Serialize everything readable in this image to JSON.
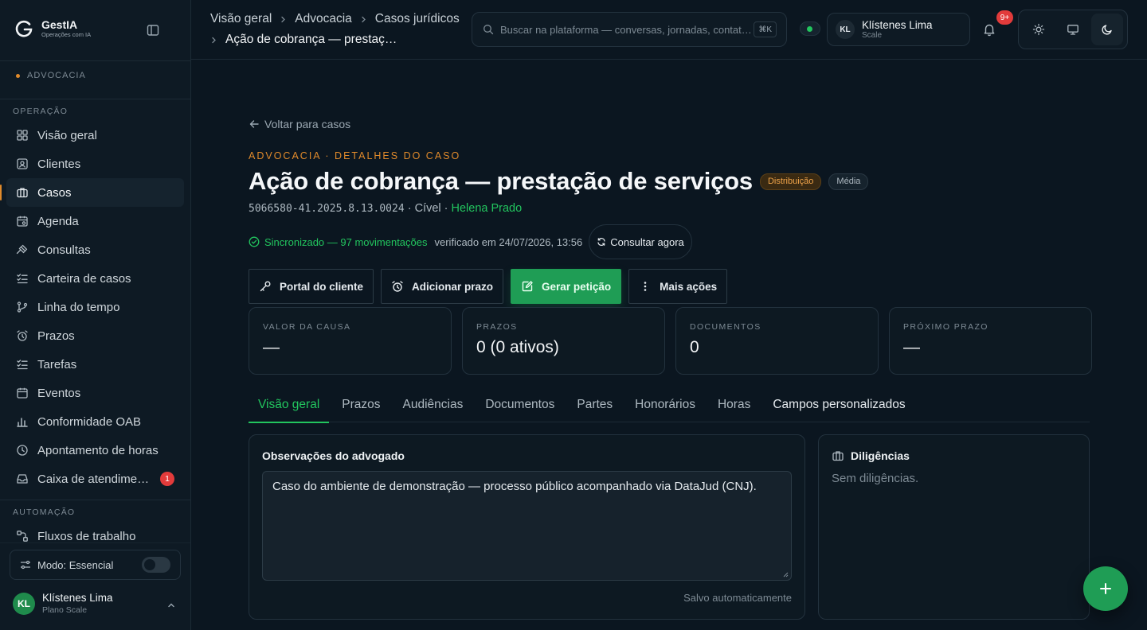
{
  "brand": {
    "name": "GestIA",
    "subtitle": "Operações com IA"
  },
  "workspace": "ADVOCACIA",
  "sidebar": {
    "section_operacao": "OPERAÇÃO",
    "section_automacao": "AUTOMAÇÃO",
    "items": [
      {
        "label": "Visão geral",
        "icon": "grid-icon"
      },
      {
        "label": "Clientes",
        "icon": "contact-icon"
      },
      {
        "label": "Casos",
        "icon": "briefcase-icon",
        "active": true
      },
      {
        "label": "Agenda",
        "icon": "calendar-icon"
      },
      {
        "label": "Consultas",
        "icon": "gavel-icon"
      },
      {
        "label": "Carteira de casos",
        "icon": "checklist-icon"
      },
      {
        "label": "Linha do tempo",
        "icon": "branch-icon"
      },
      {
        "label": "Prazos",
        "icon": "alarm-icon"
      },
      {
        "label": "Tarefas",
        "icon": "checklist-icon"
      },
      {
        "label": "Eventos",
        "icon": "calendar-icon"
      },
      {
        "label": "Conformidade OAB",
        "icon": "bar-chart-icon"
      },
      {
        "label": "Apontamento de horas",
        "icon": "clock-icon"
      },
      {
        "label": "Caixa de atendimento",
        "icon": "inbox-icon",
        "badge": "1"
      }
    ],
    "automation_items": [
      {
        "label": "Fluxos de trabalho",
        "icon": "workflow-icon"
      }
    ],
    "mode_label": "Modo: Essencial",
    "user": {
      "initials": "KL",
      "name": "Klístenes Lima",
      "plan": "Plano Scale"
    }
  },
  "topbar": {
    "breadcrumbs": [
      "Visão geral",
      "Advocacia",
      "Casos jurídicos"
    ],
    "current": "Ação de cobrança — prestação de serviços",
    "search_placeholder": "Buscar na plataforma — conversas, jornadas, contatos...",
    "search_shortcut": "⌘K",
    "account": {
      "initials": "KL",
      "name": "Klístenes Lima",
      "plan": "Scale"
    },
    "notifications": "9+"
  },
  "case": {
    "back_label": "Voltar para casos",
    "eyebrow": "ADVOCACIA · DETALHES DO CASO",
    "title": "Ação de cobrança — prestação de serviços",
    "phase": "Distribuição",
    "priority": "Média",
    "number": "5066580-41.2025.8.13.0024",
    "area": "Cível",
    "lawyer": "Helena Prado",
    "sync_status": "Sincronizado — 97 movimentações",
    "verified": "verificado em 24/07/2026, 13:56",
    "consult_label": "Consultar agora",
    "actions": {
      "portal": "Portal do cliente",
      "deadline": "Adicionar prazo",
      "petition": "Gerar petição",
      "more": "Mais ações"
    },
    "stats": [
      {
        "label": "VALOR DA CAUSA",
        "value": "—"
      },
      {
        "label": "PRAZOS",
        "value": "0 (0 ativos)"
      },
      {
        "label": "DOCUMENTOS",
        "value": "0"
      },
      {
        "label": "PRÓXIMO PRAZO",
        "value": "—"
      }
    ],
    "tabs": [
      "Visão geral",
      "Prazos",
      "Audiências",
      "Documentos",
      "Partes",
      "Honorários",
      "Horas",
      "Campos personalizados"
    ],
    "active_tab": "Visão geral",
    "notes": {
      "title": "Observações do advogado",
      "value": "Caso do ambiente de demonstração — processo público acompanhado via DataJud (CNJ).",
      "autosave": "Salvo automaticamente"
    },
    "diligences": {
      "title": "Diligências",
      "empty": "Sem diligências."
    }
  },
  "colors": {
    "accent_green": "#22c55e",
    "accent_orange": "#e08a2b",
    "background": "#0b1620",
    "badge_red": "#e23b3b"
  }
}
